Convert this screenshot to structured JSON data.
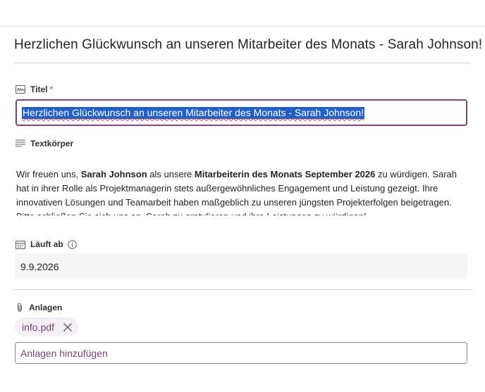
{
  "page": {
    "title": "Herzlichen Glückwunsch an unseren Mitarbeiter des Monats - Sarah Johnson!"
  },
  "fields": {
    "title": {
      "label": "Titel",
      "required_marker": "*",
      "value": "Herzlichen Glückwunsch an unseren Mitarbeiter des Monats - Sarah Johnson!",
      "icon": "text-field-icon"
    },
    "body": {
      "label": "Textkörper",
      "icon": "multiline-text-icon",
      "segments": [
        "Wir freuen uns, ",
        "Sarah Johnson",
        " als unsere ",
        "Mitarbeiterin des Monats September 2026",
        " zu würdigen. Sarah hat in ihrer Rolle als Projektmanagerin stets außergewöhnliches Engagement und Leistung gezeigt. Ihre innovativen Lösungen und Teamarbeit haben maßgeblich zu unseren jüngsten Projekterfolgen beigetragen. Bitte schließen Sie sich uns an, Sarah zu gratulieren und ihre Leistungen zu würdigen!"
      ]
    },
    "expires": {
      "label": "Läuft ab",
      "value": "9.9.2026",
      "icon": "calendar-icon",
      "info_icon": "info-icon"
    },
    "attachments": {
      "label": "Anlagen",
      "icon": "paperclip-icon",
      "files": [
        "info.pdf"
      ],
      "remove_icon": "close-icon",
      "add_label": "Anlagen hinzufügen"
    }
  },
  "colors": {
    "accent": "#7a4577",
    "selection": "#2161c7",
    "required": "#c4314b",
    "spellcheck": "#d13438",
    "field_background": "#f5f5f5"
  }
}
